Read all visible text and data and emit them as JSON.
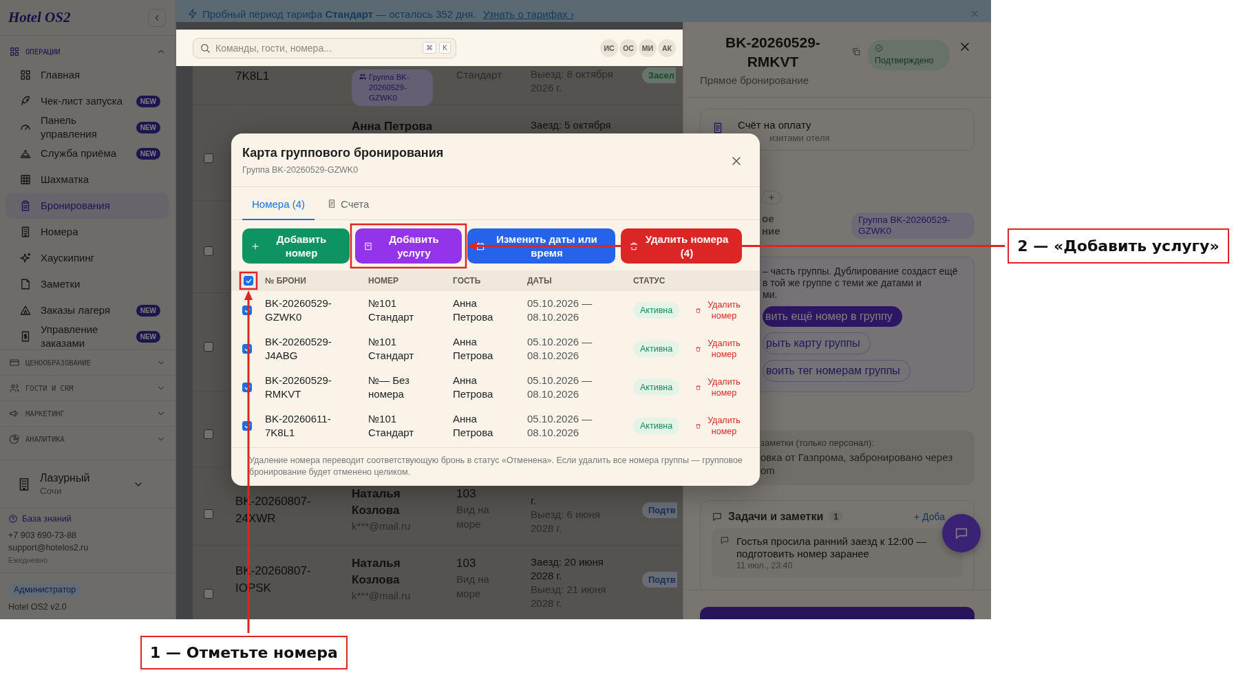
{
  "banner": {
    "text": "Пробный период тарифа **Стандарт** — осталось 352 дня.",
    "link": "Узнать о тарифах ›"
  },
  "sidebar": {
    "logo": "Hotel OS2",
    "sections": [
      {
        "label": "ОПЕРАЦИИ",
        "expanded": true,
        "items": [
          {
            "label": "Главная",
            "selected": false
          },
          {
            "label": "Чек-лист запуска",
            "badge": "NEW",
            "selected": false
          },
          {
            "label": "Панель управления",
            "badge": "NEW",
            "selected": false
          },
          {
            "label": "Служба приёма",
            "badge": "NEW",
            "selected": false
          },
          {
            "label": "Шахматка",
            "selected": false
          },
          {
            "label": "Бронирования",
            "selected": true
          },
          {
            "label": "Номера",
            "selected": false
          },
          {
            "label": "Хаускипинг",
            "selected": false
          },
          {
            "label": "Заметки",
            "selected": false
          },
          {
            "label": "Заказы лагеря",
            "badge": "NEW",
            "selected": false
          },
          {
            "label": "Управление заказами",
            "badge": "NEW",
            "selected": false
          }
        ]
      },
      {
        "label": "ЦЕНООБРАЗОВАНИЕ",
        "expanded": false
      },
      {
        "label": "ГОСТИ И CRM",
        "expanded": false
      },
      {
        "label": "МАРКЕТИНГ",
        "expanded": false
      },
      {
        "label": "АНАЛИТИКА",
        "expanded": false
      }
    ],
    "property": {
      "name": "Лазурный",
      "city": "Сочи"
    },
    "help": {
      "link": "База знаний",
      "phone": "+7 903 690-73-88",
      "email": "support@hotelos2.ru",
      "hours": "Ежедневно"
    },
    "role": "Администратор",
    "version": "Hotel OS2 v2.0"
  },
  "header": {
    "search": {
      "placeholder": "Команды, гости, номера...",
      "keys": [
        "⌘",
        "K"
      ]
    },
    "avatars": [
      "ИС",
      "ОС",
      "МИ",
      "АК"
    ]
  },
  "bookings": {
    "rows": [
      {
        "booking": "7K8L1",
        "group_tag": "Группа BK-20260529-GZWK0",
        "room_type": "Стандарт",
        "check_out": "Выезд: 8 октября\n2026 г.",
        "status": {
          "label": "Засел",
          "kind": "checked_in"
        }
      },
      {
        "checked": false,
        "guest": "Анна Петрова",
        "check_in": "Заезд: 5 октября"
      },
      {
        "checked": false
      },
      {
        "checked": false
      },
      {
        "checked": false
      },
      {
        "checked": false,
        "booking": "BK-20260807-24XWR",
        "guest": "Наталья Козлова",
        "email": "k***@mail.ru",
        "room": "103",
        "room_type": "Вид на море",
        "check_in": "г.",
        "check_out": "Выезд: 6 июня\n2028 г.",
        "status": {
          "label": "Подтв",
          "kind": "confirmed"
        }
      },
      {
        "checked": false,
        "booking": "BK-20260807-IOPSK",
        "guest": "Наталья Козлова",
        "email": "k***@mail.ru",
        "room": "103",
        "room_type": "Вид на море",
        "check_in": "Заезд: 20 июня\n2028 г.",
        "check_out": "Выезд: 21 июня\n2028 г.",
        "status": {
          "label": "Подтв",
          "kind": "confirmed"
        }
      }
    ]
  },
  "drawer": {
    "title": "BK-20260529-RMKVT",
    "status": "Подтверждено",
    "source": "Прямое бронирование",
    "invoice": {
      "title": "Счёт на оплату",
      "subtitle": "изитами отеля"
    },
    "group": {
      "label": "ое\nние",
      "tag": "Группа BK-20260529-GZWK0",
      "text": "– часть группы. Дублирование создаст ещё\nв той же группе с теми же датами и\nми.",
      "buttons": [
        {
          "label": "вить ещё номер в группу",
          "kind": "primary"
        },
        {
          "label": "рыть карту группы",
          "kind": "outline"
        },
        {
          "label": "воить тег номерам группы",
          "kind": "outline"
        }
      ]
    },
    "notes": {
      "caption": "заметки (только персонал):",
      "text": "овка от Газпрома, забронировано через\nom"
    },
    "tasks": {
      "title": "Задачи и заметки",
      "count": "1",
      "add": "+ Доба",
      "items": [
        {
          "text": "Гостья просила ранний заезд к 12:00 — подготовить номер заранее",
          "time": "11 июл., 23:40"
        }
      ]
    }
  },
  "group_modal": {
    "title": "Карта группового бронирования",
    "subtitle": "Группа BK-20260529-GZWK0",
    "tabs": [
      {
        "label": "Номера (4)",
        "selected": true
      },
      {
        "label": "Счета",
        "selected": false
      }
    ],
    "actions": [
      {
        "label": "Добавить номер",
        "kind": "add"
      },
      {
        "label": "Добавить услугу",
        "kind": "service"
      },
      {
        "label": "Изменить даты или время",
        "kind": "dates"
      },
      {
        "label": "Удалить номера (4)",
        "kind": "delete"
      }
    ],
    "columns": [
      "№ БРОНИ",
      "НОМЕР",
      "ГОСТЬ",
      "ДАТЫ",
      "СТАТУС"
    ],
    "all_checked": true,
    "rows": [
      {
        "checked": true,
        "booking": "BK-20260529-GZWK0",
        "room": "№101 Стандарт",
        "guest": "Анна Петрова",
        "dates": "05.10.2026 — 08.10.2026",
        "status": "Активна",
        "action": "Удалить номер"
      },
      {
        "checked": true,
        "booking": "BK-20260529-J4ABG",
        "room": "№101 Стандарт",
        "guest": "Анна Петрова",
        "dates": "05.10.2026 — 08.10.2026",
        "status": "Активна",
        "action": "Удалить номер"
      },
      {
        "checked": true,
        "booking": "BK-20260529-RMKVT",
        "room": "№— Без номера",
        "guest": "Анна Петрова",
        "dates": "05.10.2026 — 08.10.2026",
        "status": "Активна",
        "action": "Удалить номер"
      },
      {
        "checked": true,
        "booking": "BK-20260611-7K8L1",
        "room": "№101 Стандарт",
        "guest": "Анна Петрова",
        "dates": "05.10.2026 — 08.10.2026",
        "status": "Активна",
        "action": "Удалить номер"
      }
    ],
    "note": "Удаление номера переводит соответствующую бронь в статус «Отменена». Если удалить все номера группы — групповое бронирование будет отменено целиком."
  },
  "annotations": [
    {
      "label": "1 — Отметьте номера"
    },
    {
      "label": "2 — «Добавить услугу»"
    }
  ]
}
